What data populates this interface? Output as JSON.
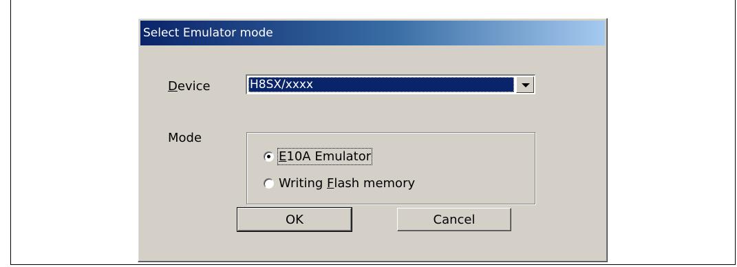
{
  "dialog": {
    "title": "Select Emulator mode",
    "device_label_accel": "D",
    "device_label_rest": "evice",
    "device_value": "H8SX/xxxx",
    "mode_label": "Mode",
    "options": [
      {
        "prefix": "",
        "accel": "E",
        "suffix": "10A Emulator",
        "selected": true
      },
      {
        "prefix": "Writing ",
        "accel": "F",
        "suffix": "lash memory",
        "selected": false
      }
    ],
    "ok_label": "OK",
    "cancel_label": "Cancel"
  }
}
